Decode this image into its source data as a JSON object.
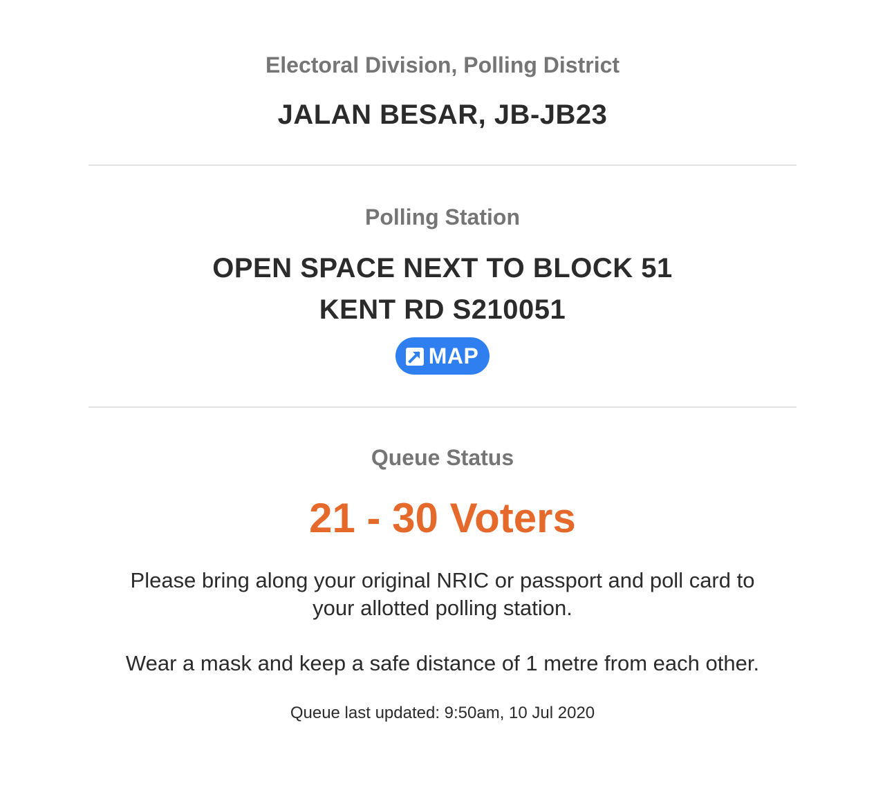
{
  "electoral": {
    "label": "Electoral Division, Polling District",
    "value": "JALAN BESAR, JB-JB23"
  },
  "polling_station": {
    "label": "Polling Station",
    "address_line1": "OPEN SPACE NEXT TO BLOCK 51",
    "address_line2": "KENT RD S210051",
    "map_button_label": "MAP",
    "map_icon": "external-link-icon"
  },
  "queue": {
    "label": "Queue Status",
    "count": "21 - 30 Voters",
    "note1": "Please bring along your original NRIC or passport and poll card to your allotted polling station.",
    "note2": "Wear a mask and keep a safe distance of 1 metre from each other.",
    "last_updated": "Queue last updated: 9:50am, 10 Jul 2020"
  },
  "colors": {
    "queue_status_color": "#e5692b",
    "map_button_bg": "#2f7ff0",
    "label_grey": "#757575",
    "divider": "#e3e3e3"
  }
}
